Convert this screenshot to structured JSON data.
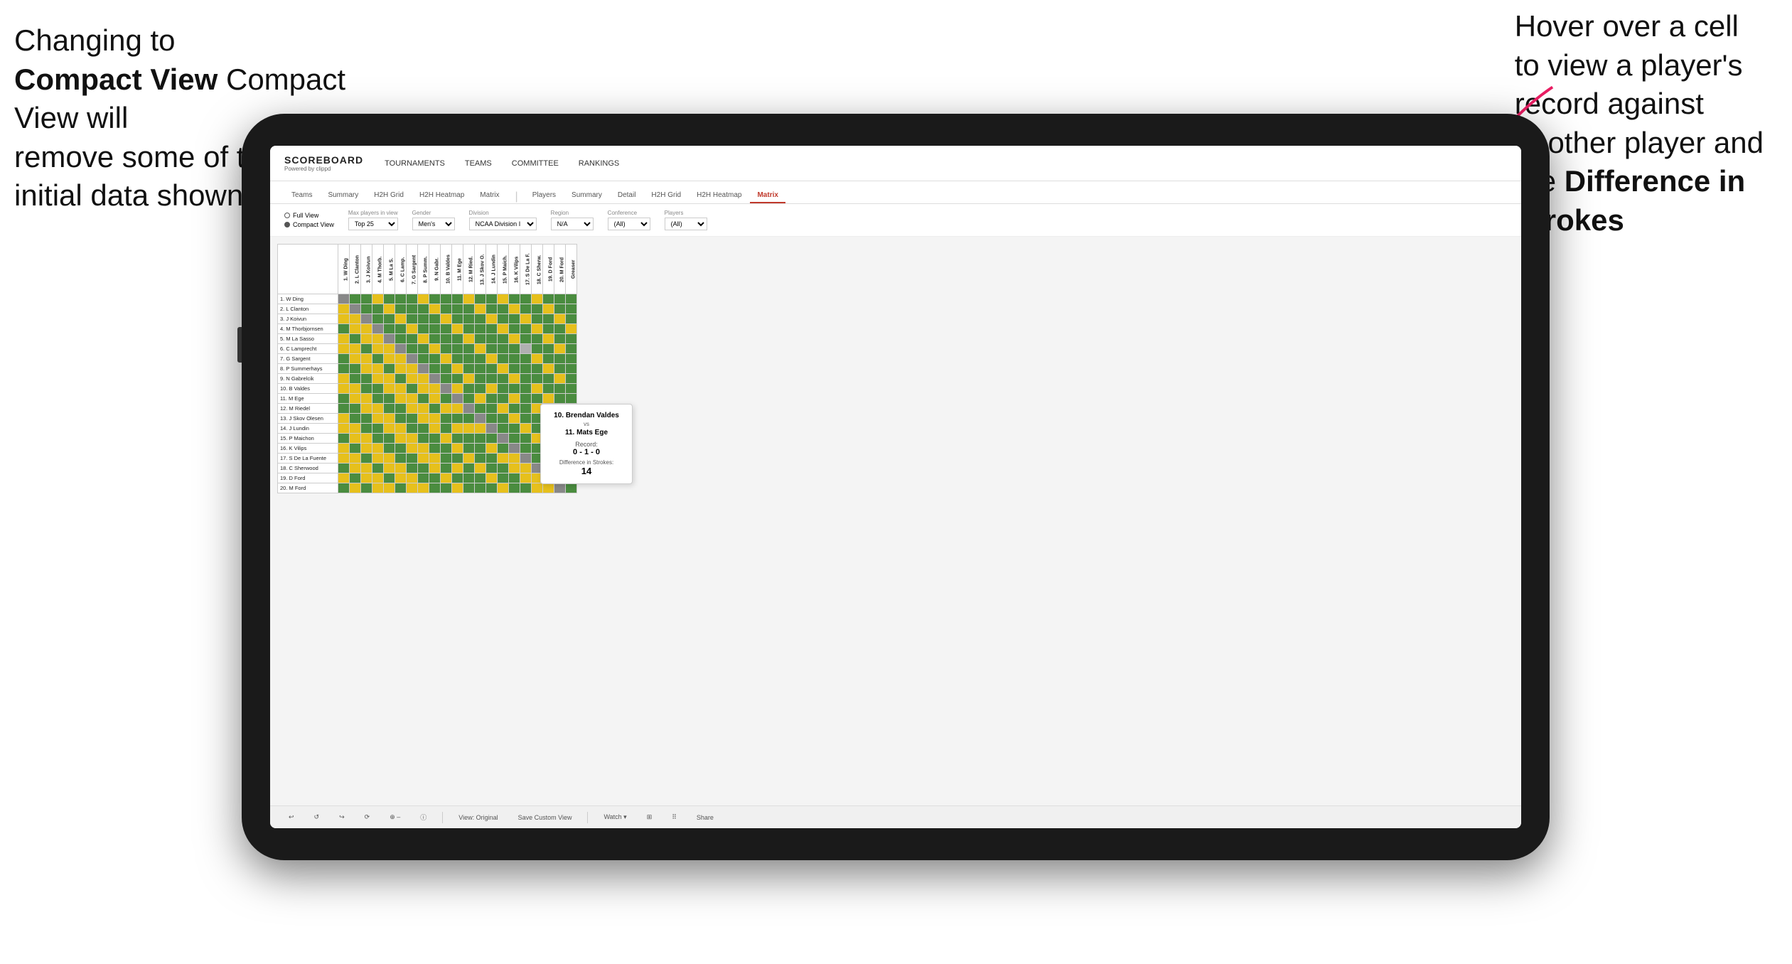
{
  "annotation_left": {
    "line1": "Changing to",
    "line2": "Compact View will",
    "line3": "remove some of the",
    "line4": "initial data shown"
  },
  "annotation_right": {
    "line1": "Hover over a cell",
    "line2": "to view a player's",
    "line3": "record against",
    "line4": "another player and",
    "line5": "the ",
    "line5b": "Difference in",
    "line6": "Strokes"
  },
  "nav": {
    "logo": "SCOREBOARD",
    "logo_sub": "Powered by clippd",
    "items": [
      "TOURNAMENTS",
      "TEAMS",
      "COMMITTEE",
      "RANKINGS"
    ]
  },
  "sub_tabs": {
    "group1": [
      "Teams",
      "Summary",
      "H2H Grid",
      "H2H Heatmap",
      "Matrix"
    ],
    "group2_active": "Matrix",
    "group2": [
      "Players",
      "Summary",
      "Detail",
      "H2H Grid",
      "H2H Heatmap",
      "Matrix"
    ]
  },
  "controls": {
    "view_full": "Full View",
    "view_compact": "Compact View",
    "max_players_label": "Max players in view",
    "max_players_value": "Top 25",
    "gender_label": "Gender",
    "gender_value": "Men's",
    "division_label": "Division",
    "division_value": "NCAA Division I",
    "region_label": "Region",
    "region_value": "N/A",
    "conference_label": "Conference",
    "conference_value": "(All)",
    "players_label": "Players",
    "players_value": "(All)"
  },
  "players": [
    "1. W Ding",
    "2. L Clanton",
    "3. J Koivun",
    "4. M Thorbjornsen",
    "5. M La Sasso",
    "6. C Lamprecht",
    "7. G Sargent",
    "8. P Summerhays",
    "9. N Gabrelcik",
    "10. B Valdes",
    "11. M Ege",
    "12. M Riedel",
    "13. J Skov Olesen",
    "14. J Lundin",
    "15. P Maichon",
    "16. K Vilips",
    "17. S De La Fuente",
    "18. C Sherwood",
    "19. D Ford",
    "20. M Ford"
  ],
  "col_headers": [
    "1. W Ding",
    "2. L Clanton",
    "3. J Koivun",
    "4. M Thorb.",
    "5. M La S.",
    "6. C Lamp.",
    "7. G Sargent",
    "8. P Summ.",
    "9. N Gabr.",
    "10. B Valdes",
    "11. M Ege",
    "12. M Ried.",
    "13. J Skov O.",
    "14. J Lundin",
    "15. P Maich.",
    "16. K Vilips",
    "17. S De La F.",
    "18. C Sherw.",
    "19. D Ford",
    "20. M Ford",
    "Greaser"
  ],
  "tooltip": {
    "player1": "10. Brendan Valdes",
    "vs": "vs",
    "player2": "11. Mats Ege",
    "record_label": "Record:",
    "record": "0 - 1 - 0",
    "diff_label": "Difference in Strokes:",
    "diff_val": "14"
  },
  "toolbar": {
    "undo": "↩",
    "redo": "↪",
    "view_original": "View: Original",
    "save_custom": "Save Custom View",
    "watch": "Watch ▾",
    "share": "Share"
  }
}
